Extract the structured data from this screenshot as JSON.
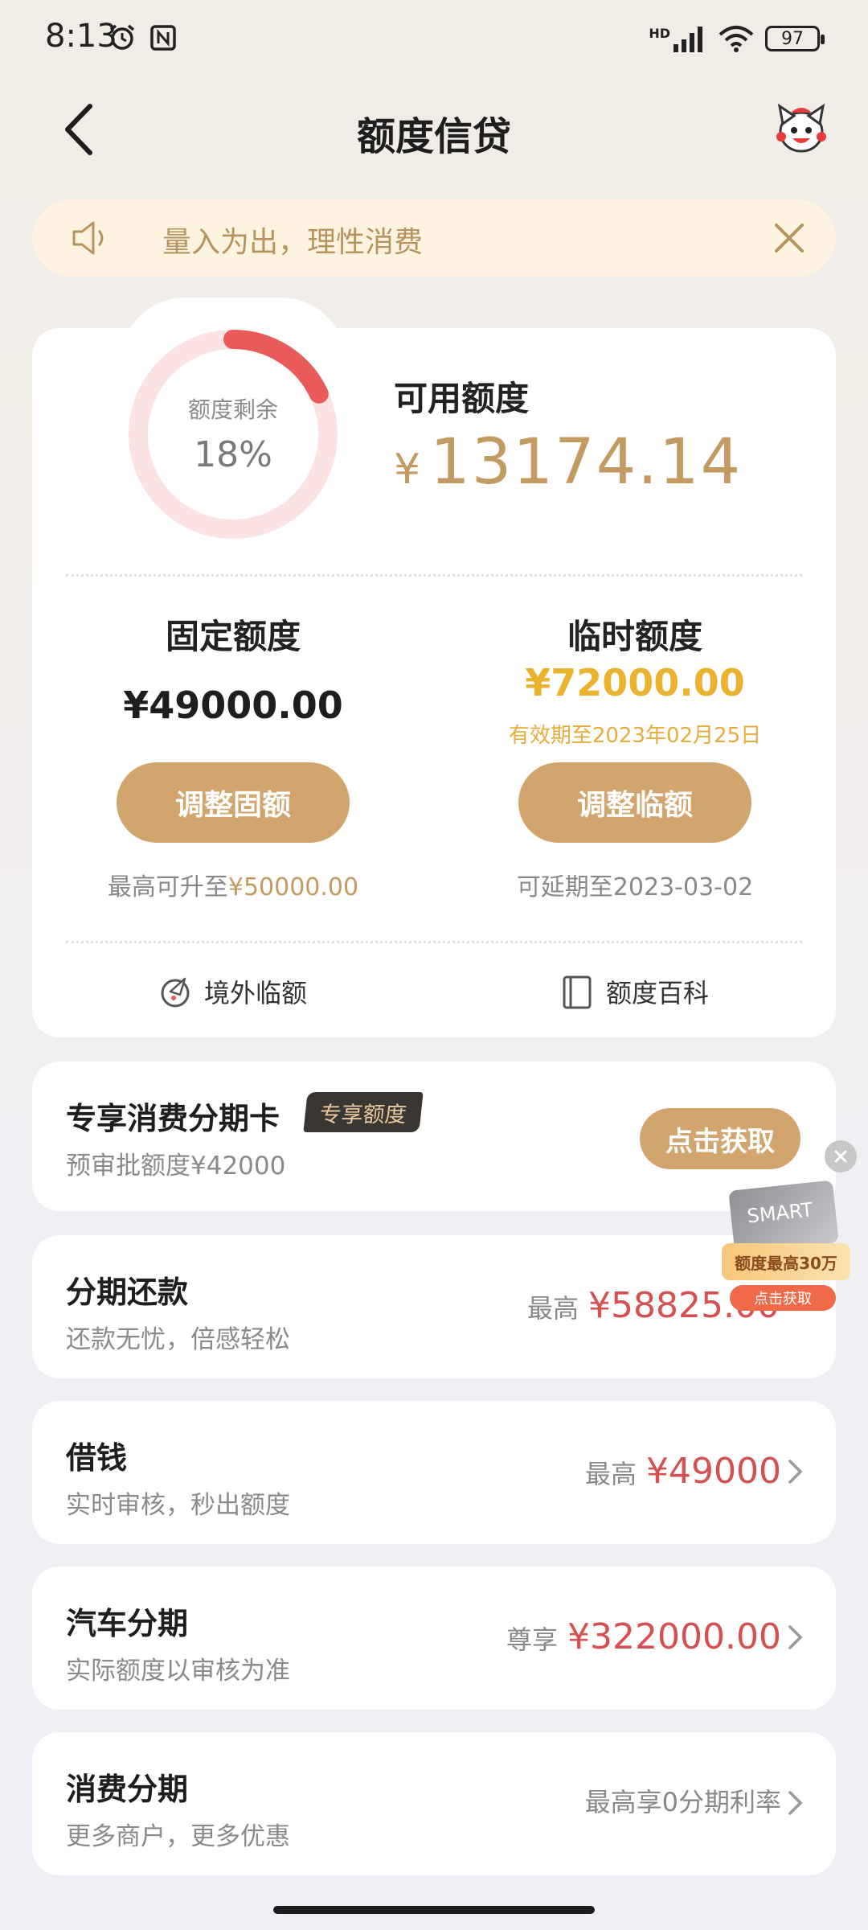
{
  "status_bar": {
    "time": "8:13",
    "battery": "97",
    "network": "HD"
  },
  "header": {
    "title": "额度信贷"
  },
  "notice": {
    "text": "量入为出，理性消费"
  },
  "limit_card": {
    "ring_label": "额度剩余",
    "ring_percent": "18%",
    "remaining_fraction": 0.18,
    "available_label": "可用额度",
    "available_currency": "¥",
    "available_amount": "13174.14",
    "fixed": {
      "title": "固定额度",
      "amount": "¥49000.00",
      "button": "调整固额",
      "note_prefix": "最高可升至",
      "note_value": "¥50000.00"
    },
    "temporary": {
      "title": "临时额度",
      "amount": "¥72000.00",
      "valid_until": "有效期至2023年02月25日",
      "button": "调整临额",
      "note": "可延期至2023-03-02"
    },
    "links": {
      "overseas": "境外临额",
      "wiki": "额度百科"
    }
  },
  "installment_card": {
    "title": "专享消费分期卡",
    "tag": "专享额度",
    "subtitle": "预审批额度¥42000",
    "button": "点击获取"
  },
  "products": [
    {
      "title": "分期还款",
      "subtitle": "还款无忧，倍感轻松",
      "prefix": "最高",
      "amount": "¥58825.00"
    },
    {
      "title": "借钱",
      "subtitle": "实时审核，秒出额度",
      "prefix": "最高",
      "amount": "¥49000"
    },
    {
      "title": "汽车分期",
      "subtitle": "实际额度以审核为准",
      "prefix": "尊享",
      "amount": "¥322000.00"
    },
    {
      "title": "消费分期",
      "subtitle": "更多商户，更多优惠",
      "prefix": "最高享0分期利率",
      "amount": ""
    }
  ],
  "promo": {
    "card_text": "SMART",
    "ribbon": "额度最高30万",
    "cta": "点击获取"
  },
  "colors": {
    "gold": "#c49a63",
    "button": "#d1a56d",
    "red": "#d6504f",
    "yellow": "#e9b32e",
    "ring_track": "#fbe3e3",
    "ring_fill": "#e95a5a"
  }
}
